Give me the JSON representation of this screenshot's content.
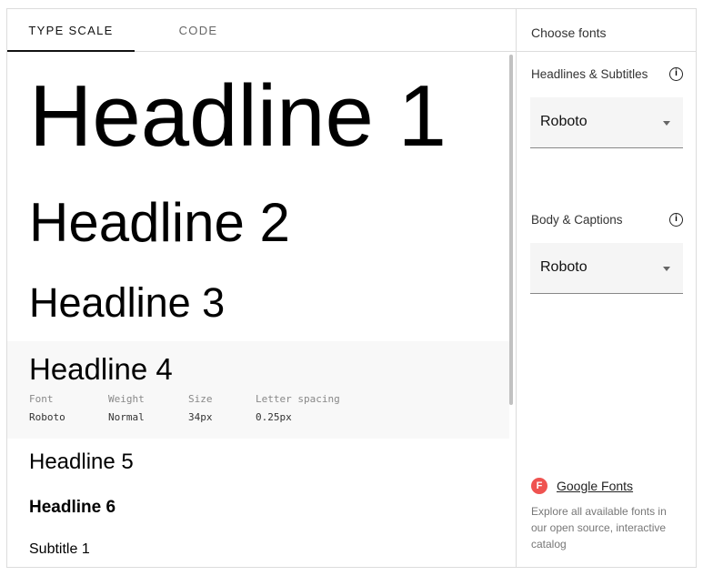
{
  "tabs": [
    "TYPE SCALE",
    "CODE"
  ],
  "headlines": [
    "Headline 1",
    "Headline 2",
    "Headline 3",
    "Headline 4",
    "Headline 5",
    "Headline 6",
    "Subtitle 1"
  ],
  "h4_meta": {
    "labels": [
      "Font",
      "Weight",
      "Size",
      "Letter spacing"
    ],
    "values": [
      "Roboto",
      "Normal",
      "34px",
      "0.25px"
    ]
  },
  "panel": {
    "title": "Choose fonts",
    "headlines_label": "Headlines & Subtitles",
    "headlines_font": "Roboto",
    "body_label": "Body & Captions",
    "body_font": "Roboto",
    "info_glyph": "i",
    "gf_icon": "F",
    "gf_link": "Google Fonts",
    "gf_desc": "Explore all available fonts in our open source, interactive catalog"
  }
}
